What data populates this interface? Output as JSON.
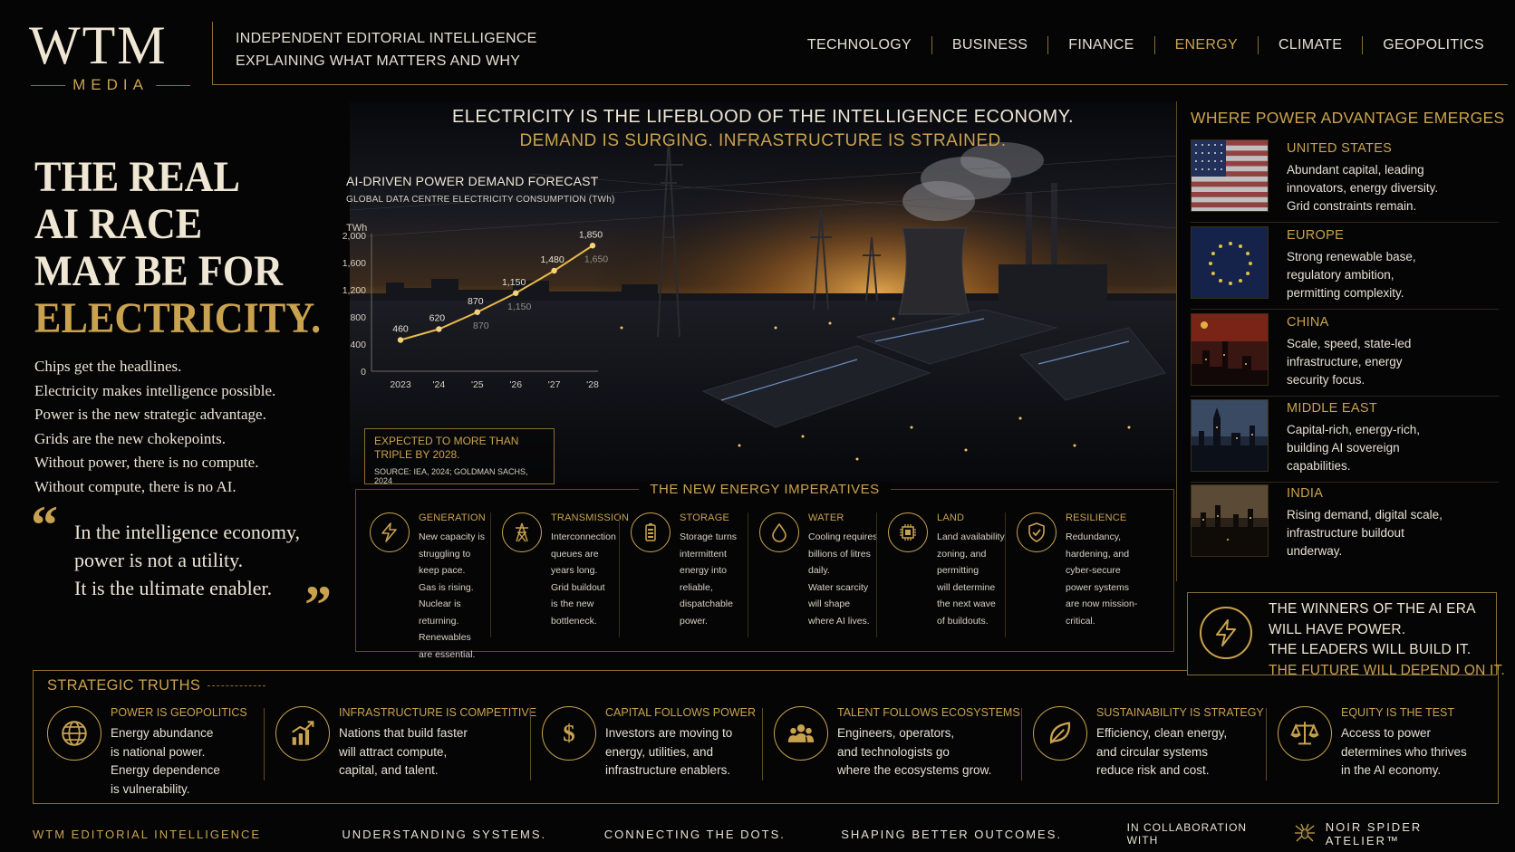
{
  "header": {
    "logo_main": "WTM",
    "logo_sub": "MEDIA",
    "tagline_line1": "INDEPENDENT EDITORIAL INTELLIGENCE",
    "tagline_line2": "EXPLAINING WHAT MATTERS AND WHY",
    "nav": [
      {
        "label": "TECHNOLOGY"
      },
      {
        "label": "BUSINESS"
      },
      {
        "label": "FINANCE"
      },
      {
        "label": "ENERGY",
        "active": true
      },
      {
        "label": "CLIMATE"
      },
      {
        "label": "GEOPOLITICS"
      }
    ]
  },
  "left": {
    "headline_lines": [
      "THE REAL",
      "AI RACE",
      "MAY BE FOR",
      "ELECTRICITY."
    ],
    "intro_lines": [
      "Chips get the headlines.",
      "Electricity makes intelligence possible.",
      "Power is the new strategic advantage.",
      "Grids are the new chokepoints.",
      "Without power, there is no compute.",
      "Without compute, there is no AI."
    ],
    "quote_lines": [
      "In the intelligence economy,",
      "power is not a utility.",
      "It is the ultimate enabler."
    ]
  },
  "hero": {
    "title": "ELECTRICITY IS THE LIFEBLOOD OF THE INTELLIGENCE ECONOMY.",
    "subtitle": "DEMAND IS SURGING. INFRASTRUCTURE IS STRAINED."
  },
  "chart_data": {
    "type": "line",
    "title": "AI-DRIVEN POWER DEMAND FORECAST",
    "subtitle": "GLOBAL DATA CENTRE ELECTRICITY CONSUMPTION (TWh)",
    "ylabel": "TWh",
    "xlabel": "",
    "categories": [
      "2023",
      "'24",
      "'25",
      "'26",
      "'27",
      "'28"
    ],
    "yticks": [
      "2,000",
      "1,600",
      "1,200",
      "800",
      "400",
      "0"
    ],
    "ylim": [
      0,
      2000
    ],
    "series": [
      {
        "values": [
          460,
          620,
          870,
          1150,
          1480,
          1850
        ]
      }
    ],
    "data_labels": [
      "460",
      "620",
      "870",
      "1,150",
      "1,480",
      "1,850"
    ],
    "ghost_labels": [
      "870",
      "1,150",
      "1,650"
    ],
    "grid": false,
    "line_color": "#e8b94a"
  },
  "callout": {
    "text": "EXPECTED TO MORE THAN TRIPLE BY 2028.",
    "source": "SOURCE: IEA, 2024; GOLDMAN SACHS, 2024"
  },
  "imperatives": {
    "title": "THE NEW ENERGY IMPERATIVES",
    "items": [
      {
        "icon": "lightning-icon",
        "heading": "GENERATION",
        "lines": [
          "New capacity is",
          "struggling to",
          "keep pace.",
          "Gas is rising.",
          "Nuclear is",
          "returning.",
          "Renewables",
          "are essential."
        ]
      },
      {
        "icon": "transmission-tower-icon",
        "heading": "TRANSMISSION",
        "lines": [
          "Interconnection",
          "queues are",
          "years long.",
          "Grid buildout",
          "is the new",
          "bottleneck."
        ]
      },
      {
        "icon": "battery-icon",
        "heading": "STORAGE",
        "lines": [
          "Storage turns",
          "intermittent",
          "energy into",
          "reliable,",
          "dispatchable",
          "power."
        ]
      },
      {
        "icon": "water-drop-icon",
        "heading": "WATER",
        "lines": [
          "Cooling requires",
          "billions of litres",
          "daily.",
          "Water scarcity",
          "will shape",
          "where AI lives."
        ]
      },
      {
        "icon": "chip-icon",
        "heading": "LAND",
        "lines": [
          "Land availability,",
          "zoning, and",
          "permitting",
          "will determine",
          "the next wave",
          "of buildouts."
        ]
      },
      {
        "icon": "shield-check-icon",
        "heading": "RESILIENCE",
        "lines": [
          "Redundancy,",
          "hardening, and",
          "cyber-secure",
          "power systems",
          "are now mission-",
          "critical."
        ]
      }
    ]
  },
  "regions": {
    "title": "WHERE POWER ADVANTAGE EMERGES",
    "items": [
      {
        "name": "UNITED STATES",
        "lines": [
          "Abundant capital, leading",
          "innovators, energy diversity.",
          "Grid constraints remain."
        ]
      },
      {
        "name": "EUROPE",
        "lines": [
          "Strong renewable base,",
          "regulatory ambition,",
          "permitting complexity."
        ]
      },
      {
        "name": "CHINA",
        "lines": [
          "Scale, speed, state-led",
          "infrastructure, energy",
          "security focus."
        ]
      },
      {
        "name": "MIDDLE EAST",
        "lines": [
          "Capital-rich, energy-rich,",
          "building AI sovereign",
          "capabilities."
        ]
      },
      {
        "name": "INDIA",
        "lines": [
          "Rising demand, digital scale,",
          "infrastructure buildout",
          "underway."
        ]
      }
    ]
  },
  "winners": {
    "lines": [
      "THE WINNERS OF THE AI ERA",
      "WILL HAVE POWER.",
      "THE LEADERS WILL BUILD IT."
    ],
    "highlight": "THE FUTURE WILL DEPEND ON IT."
  },
  "truths": {
    "title": "STRATEGIC TRUTHS",
    "items": [
      {
        "icon": "globe-icon",
        "heading": "POWER IS GEOPOLITICS",
        "lines": [
          "Energy abundance",
          "is national power.",
          "Energy dependence",
          "is vulnerability."
        ]
      },
      {
        "icon": "growth-chart-icon",
        "heading": "INFRASTRUCTURE IS COMPETITIVE",
        "lines": [
          "Nations that build faster",
          "will attract compute,",
          "capital, and talent."
        ]
      },
      {
        "icon": "dollar-icon",
        "heading": "CAPITAL FOLLOWS POWER",
        "lines": [
          "Investors are moving to",
          "energy, utilities, and",
          "infrastructure enablers."
        ]
      },
      {
        "icon": "people-icon",
        "heading": "TALENT FOLLOWS ECOSYSTEMS",
        "lines": [
          "Engineers, operators,",
          "and technologists go",
          "where the ecosystems grow."
        ]
      },
      {
        "icon": "leaf-icon",
        "heading": "SUSTAINABILITY IS STRATEGY",
        "lines": [
          "Efficiency, clean energy,",
          "and circular systems",
          "reduce risk and cost."
        ]
      },
      {
        "icon": "scales-icon",
        "heading": "EQUITY IS THE TEST",
        "lines": [
          "Access to power",
          "determines who thrives",
          "in the AI economy."
        ]
      }
    ]
  },
  "footer": {
    "brand": "WTM EDITORIAL INTELLIGENCE",
    "m1": "UNDERSTANDING SYSTEMS.",
    "m2": "CONNECTING THE DOTS.",
    "m3": "SHAPING BETTER OUTCOMES.",
    "collab": "IN COLLABORATION WITH",
    "partner": "NOIR SPIDER ATELIER™"
  },
  "colors": {
    "accent": "#c9a24f",
    "background": "#050505",
    "text": "#e6e0d4"
  }
}
